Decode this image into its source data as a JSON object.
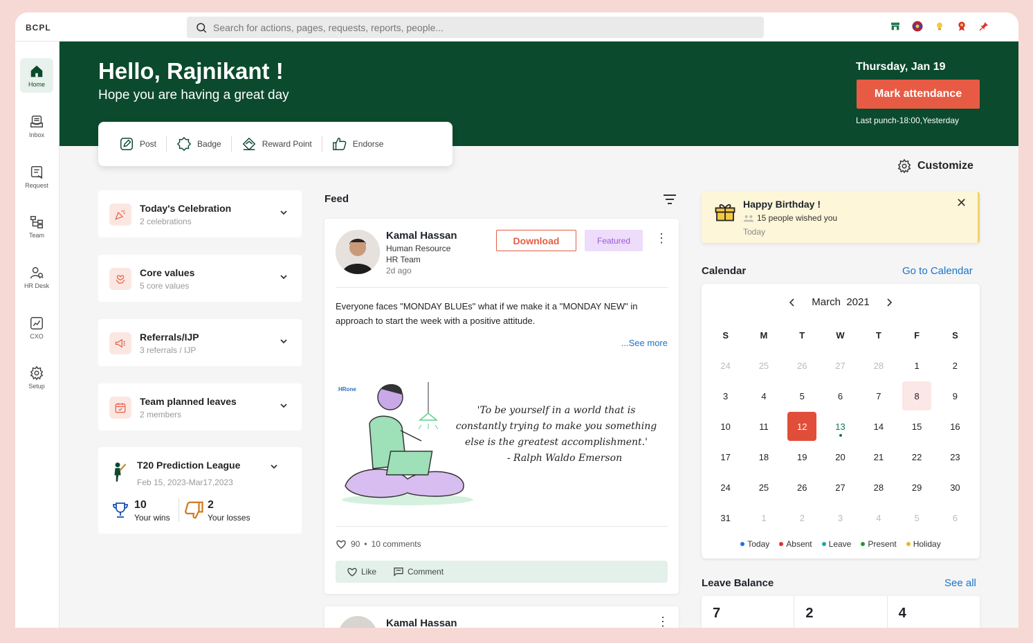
{
  "brand": "BCPL",
  "search": {
    "placeholder": "Search for actions, pages, requests, reports, people..."
  },
  "top_icons": [
    "store-icon",
    "cricket-badge-icon",
    "bulb-icon",
    "award-icon",
    "pin-icon"
  ],
  "sidebar": {
    "items": [
      {
        "label": "Home",
        "icon": "home-icon",
        "active": true
      },
      {
        "label": "Inbox",
        "icon": "inbox-icon"
      },
      {
        "label": "Request",
        "icon": "request-icon"
      },
      {
        "label": "Team",
        "icon": "team-icon"
      },
      {
        "label": "HR Desk",
        "icon": "hr-desk-icon"
      },
      {
        "label": "CXO",
        "icon": "cxo-icon"
      },
      {
        "label": "Setup",
        "icon": "gear-icon"
      }
    ]
  },
  "hero": {
    "greeting": "Hello, Rajnikant !",
    "sub": "Hope you are having a great day",
    "date": "Thursday, Jan 19",
    "mark_attendance": "Mark attendance",
    "last_punch": "Last punch-18:00,Yesterday"
  },
  "quick_actions": [
    {
      "label": "Post",
      "icon": "pencil-icon"
    },
    {
      "label": "Badge",
      "icon": "badge-icon"
    },
    {
      "label": "Reward Point",
      "icon": "diamond-icon"
    },
    {
      "label": "Endorse",
      "icon": "thumbs-up-icon"
    }
  ],
  "customize": "Customize",
  "left_cards": [
    {
      "title": "Today's Celebration",
      "sub": "2 celebrations",
      "icon": "party-icon"
    },
    {
      "title": "Core values",
      "sub": "5 core values",
      "icon": "values-icon"
    },
    {
      "title": "Referrals/IJP",
      "sub": "3 referrals / IJP",
      "icon": "megaphone-icon"
    },
    {
      "title": "Team planned leaves",
      "sub": "2 members",
      "icon": "calendar-icon"
    }
  ],
  "t20": {
    "title": "T20 Prediction League",
    "dates": "Feb 15, 2023-Mar17,2023",
    "wins": "10",
    "wins_label": "Your wins",
    "losses": "2",
    "losses_label": "Your losses"
  },
  "feed": {
    "title": "Feed",
    "post": {
      "name": "Kamal Hassan",
      "role": "Human Resource",
      "team": "HR Team",
      "time": "2d ago",
      "download": "Download",
      "featured": "Featured",
      "text": "Everyone faces \"MONDAY BLUEs\" what if we make it a \"MONDAY NEW\" in approach to start the week with a positive attitude.",
      "see_more": "...See more",
      "logo_text": "HRone",
      "quote": "'To be yourself in a world that is constantly trying to make you something else is the greatest accomplishment.'",
      "quote_author": "- Ralph Waldo Emerson",
      "likes": "90",
      "comments": "10 comments",
      "like_label": "Like",
      "comment_label": "Comment"
    },
    "post2": {
      "name": "Kamal Hassan"
    }
  },
  "birthday": {
    "title": "Happy Birthday !",
    "wishes": "15 people wished you",
    "when": "Today"
  },
  "calendar": {
    "title": "Calendar",
    "link": "Go to Calendar",
    "month": "March",
    "year": "2021",
    "dow": [
      "S",
      "M",
      "T",
      "W",
      "T",
      "F",
      "S"
    ],
    "weeks": [
      [
        "24",
        "25",
        "26",
        "27",
        "28",
        "1",
        "2"
      ],
      [
        "3",
        "4",
        "5",
        "6",
        "7",
        "8",
        "9"
      ],
      [
        "10",
        "11",
        "12",
        "13",
        "14",
        "15",
        "16"
      ],
      [
        "17",
        "18",
        "19",
        "20",
        "21",
        "22",
        "23"
      ],
      [
        "24",
        "25",
        "26",
        "27",
        "28",
        "29",
        "30"
      ],
      [
        "31",
        "1",
        "2",
        "3",
        "4",
        "5",
        "6"
      ]
    ],
    "selected": "12",
    "today": "13",
    "highlight": "8",
    "legend": [
      {
        "label": "Today",
        "color": "#1a73e8"
      },
      {
        "label": "Absent",
        "color": "#e0302a"
      },
      {
        "label": "Leave",
        "color": "#1aa8a8"
      },
      {
        "label": "Present",
        "color": "#1e9a3c"
      },
      {
        "label": "Holiday",
        "color": "#f0b429"
      }
    ]
  },
  "leave_balance": {
    "title": "Leave Balance",
    "link": "See all",
    "values": [
      "7",
      "2",
      "4"
    ]
  },
  "colors": {
    "primary": "#0b4a2d",
    "accent": "#e75b45",
    "link": "#1a73c9"
  }
}
